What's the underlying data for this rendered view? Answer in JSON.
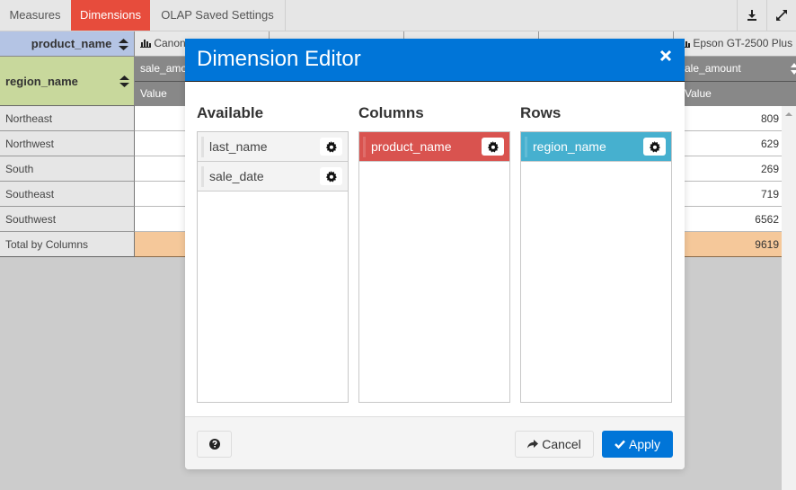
{
  "toolbar": {
    "tabs": [
      {
        "label": "Measures",
        "active": false
      },
      {
        "label": "Dimensions",
        "active": true
      },
      {
        "label": "OLAP Saved Settings",
        "active": false
      }
    ],
    "icons": [
      "download-icon",
      "fullscreen-icon"
    ]
  },
  "pivot": {
    "column_dimension": "product_name",
    "row_dimension": "region_name",
    "columns": [
      {
        "label": "Canon",
        "measure": "sale_amo",
        "sub": "Value"
      },
      {
        "label": "Epson GT-2500 Plus",
        "measure": "ale_amount",
        "sub": "Value"
      }
    ],
    "rows": [
      {
        "label": "Northeast",
        "value": "809"
      },
      {
        "label": "Northwest",
        "value": "629"
      },
      {
        "label": "South",
        "value": "269"
      },
      {
        "label": "Southeast",
        "value": "719"
      },
      {
        "label": "Southwest",
        "value": "6562"
      }
    ],
    "total": {
      "label": "Total by Columns",
      "value": "9619"
    }
  },
  "modal": {
    "title": "Dimension Editor",
    "available": {
      "title": "Available",
      "items": [
        "last_name",
        "sale_date"
      ]
    },
    "columns": {
      "title": "Columns",
      "items": [
        "product_name"
      ]
    },
    "rows": {
      "title": "Rows",
      "items": [
        "region_name"
      ]
    },
    "footer": {
      "cancel_label": "Cancel",
      "apply_label": "Apply"
    }
  },
  "colors": {
    "accent_blue": "#0075d8",
    "active_tab_red": "#e74c3c",
    "columns_item": "#d9534f",
    "rows_item": "#46b0cf",
    "total_row": "#f5c89a"
  }
}
